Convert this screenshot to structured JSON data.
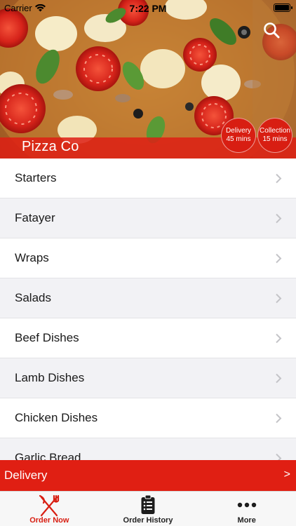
{
  "status_bar": {
    "carrier": "Carrier",
    "time": "7:22 PM"
  },
  "hero": {
    "restaurant_name": "Pizza Co",
    "delivery_badge": {
      "label": "Delivery",
      "time": "45 mins"
    },
    "collection_badge": {
      "label": "Collection",
      "time": "15 mins"
    }
  },
  "menu": {
    "categories": [
      "Starters",
      "Fatayer",
      "Wraps",
      "Salads",
      "Beef Dishes",
      "Lamb Dishes",
      "Chicken Dishes",
      "Garlic Bread"
    ]
  },
  "order_bar": {
    "mode_label": "Delivery",
    "arrow": ">"
  },
  "tab_bar": {
    "tabs": [
      {
        "label": "Order Now",
        "icon": "fork-knife-icon"
      },
      {
        "label": "Order History",
        "icon": "clipboard-list-icon"
      },
      {
        "label": "More",
        "icon": "more-dots-icon"
      }
    ]
  },
  "colors": {
    "brand_red": "#e01f13",
    "row_alt": "#f2f2f5",
    "tab_active": "#d81e12"
  }
}
